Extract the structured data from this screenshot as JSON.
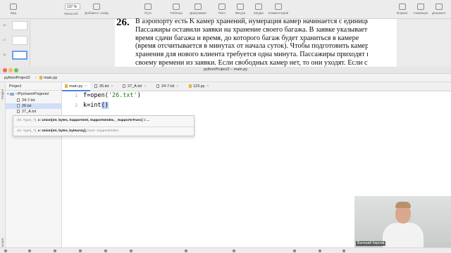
{
  "toolbar": {
    "zoom": "137 %",
    "items": [
      "Вид",
      "Масштаб",
      "Добавить слайд",
      "Пуск",
      "Таблица",
      "Диаграмма",
      "Текст",
      "Фигура",
      "Медиа",
      "Комментарий",
      "Формат",
      "Анимация",
      "Документ"
    ]
  },
  "slide_nav": {
    "numbers": [
      "16",
      "17",
      "18"
    ]
  },
  "slide": {
    "task_number": "26.",
    "lines": [
      "В аэропорту есть K камер хранений, нумерация камер начинается с единицы.",
      "Пассажиры оставили заявки на хранение своего багажа. В заявке указывается",
      "время сдачи багажа и время, до которого багаж будет храниться в камере",
      "(время отсчитывается в минутах от начала суток). Чтобы подготовить камеру",
      "хранения для нового клиента требуется одна минута. Пассажиры приходят к",
      "своему времени из заявки. Если свободных камер нет, то они уходят. Если сво-"
    ]
  },
  "pycharm": {
    "window_title": "pythonProject2 – main.py",
    "nav": {
      "project": "pythonProject2",
      "file": "main.py"
    },
    "project_panel": {
      "title": "Project",
      "rows": [
        "~/PycharmProjects/",
        "24-7.txt",
        "26.txt",
        "27_A.txt"
      ]
    },
    "tabs": [
      "main.py",
      "26.txt",
      "27_A.txt",
      "24-7.txt",
      "123.py"
    ],
    "code_lines": [
      {
        "num": "1",
        "pre": "f=open(",
        "str": "'26.txt'",
        "post": ")"
      },
      {
        "num": "2",
        "pre": "k=int",
        "cursor": "()",
        "post": ""
      }
    ],
    "param_hint": {
      "line1_prefix": "cls: Type[_T],",
      "line1_bold": "x: Union[str, bytes, SupportsInt, SupportsIndex, _SupportsTrunc] = ...",
      "line2_prefix": "cls: Type[_T],",
      "line2_bold": "x: Union[str, bytes, bytearray],",
      "line2_suffix": "base: SupportsIndex"
    },
    "left_stripe": {
      "project_label": "Project",
      "structure_label": "Structure"
    }
  },
  "webcam": {
    "name": "Валерий Карпов"
  },
  "colors": {
    "active_tab": "#4a88e0",
    "string": "#227a1f",
    "selection": "#cfdff8"
  }
}
